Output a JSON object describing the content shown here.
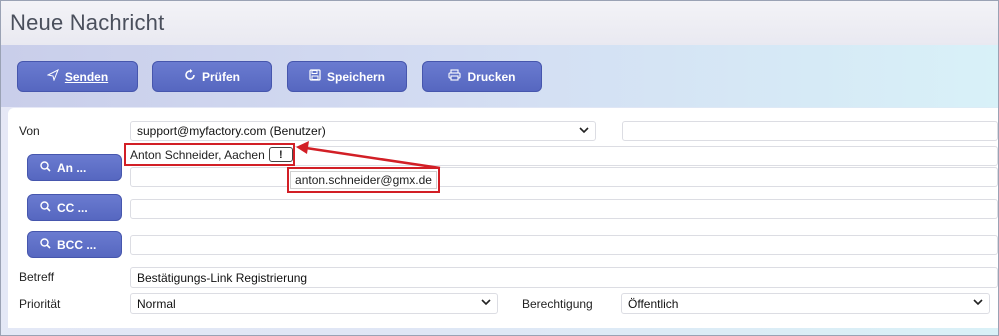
{
  "window": {
    "title": "Neue Nachricht"
  },
  "toolbar": {
    "send_label": "Senden",
    "check_label": "Prüfen",
    "save_label": "Speichern",
    "print_label": "Drucken"
  },
  "form": {
    "von_label": "Von",
    "von_value": "support@myfactory.com (Benutzer)",
    "an_button": "An ...",
    "recipient_name": "Anton Schneider, Aachen",
    "recipient_flag": "!",
    "recipient_email": "anton.schneider@gmx.de",
    "cc_button": "CC ...",
    "bcc_button": "BCC ...",
    "betreff_label": "Betreff",
    "betreff_value": "Bestätigungs-Link Registrierung",
    "prioritaet_label": "Priorität",
    "prioritaet_value": "Normal",
    "berechtigung_label": "Berechtigung",
    "berechtigung_value": "Öffentlich"
  },
  "colors": {
    "button_blue": "#5a6bc4",
    "highlight_red": "#d21f26"
  },
  "icons": {
    "send": "paper-plane-icon",
    "check": "refresh-icon",
    "save": "floppy-icon",
    "print": "printer-icon",
    "search": "search-icon"
  }
}
